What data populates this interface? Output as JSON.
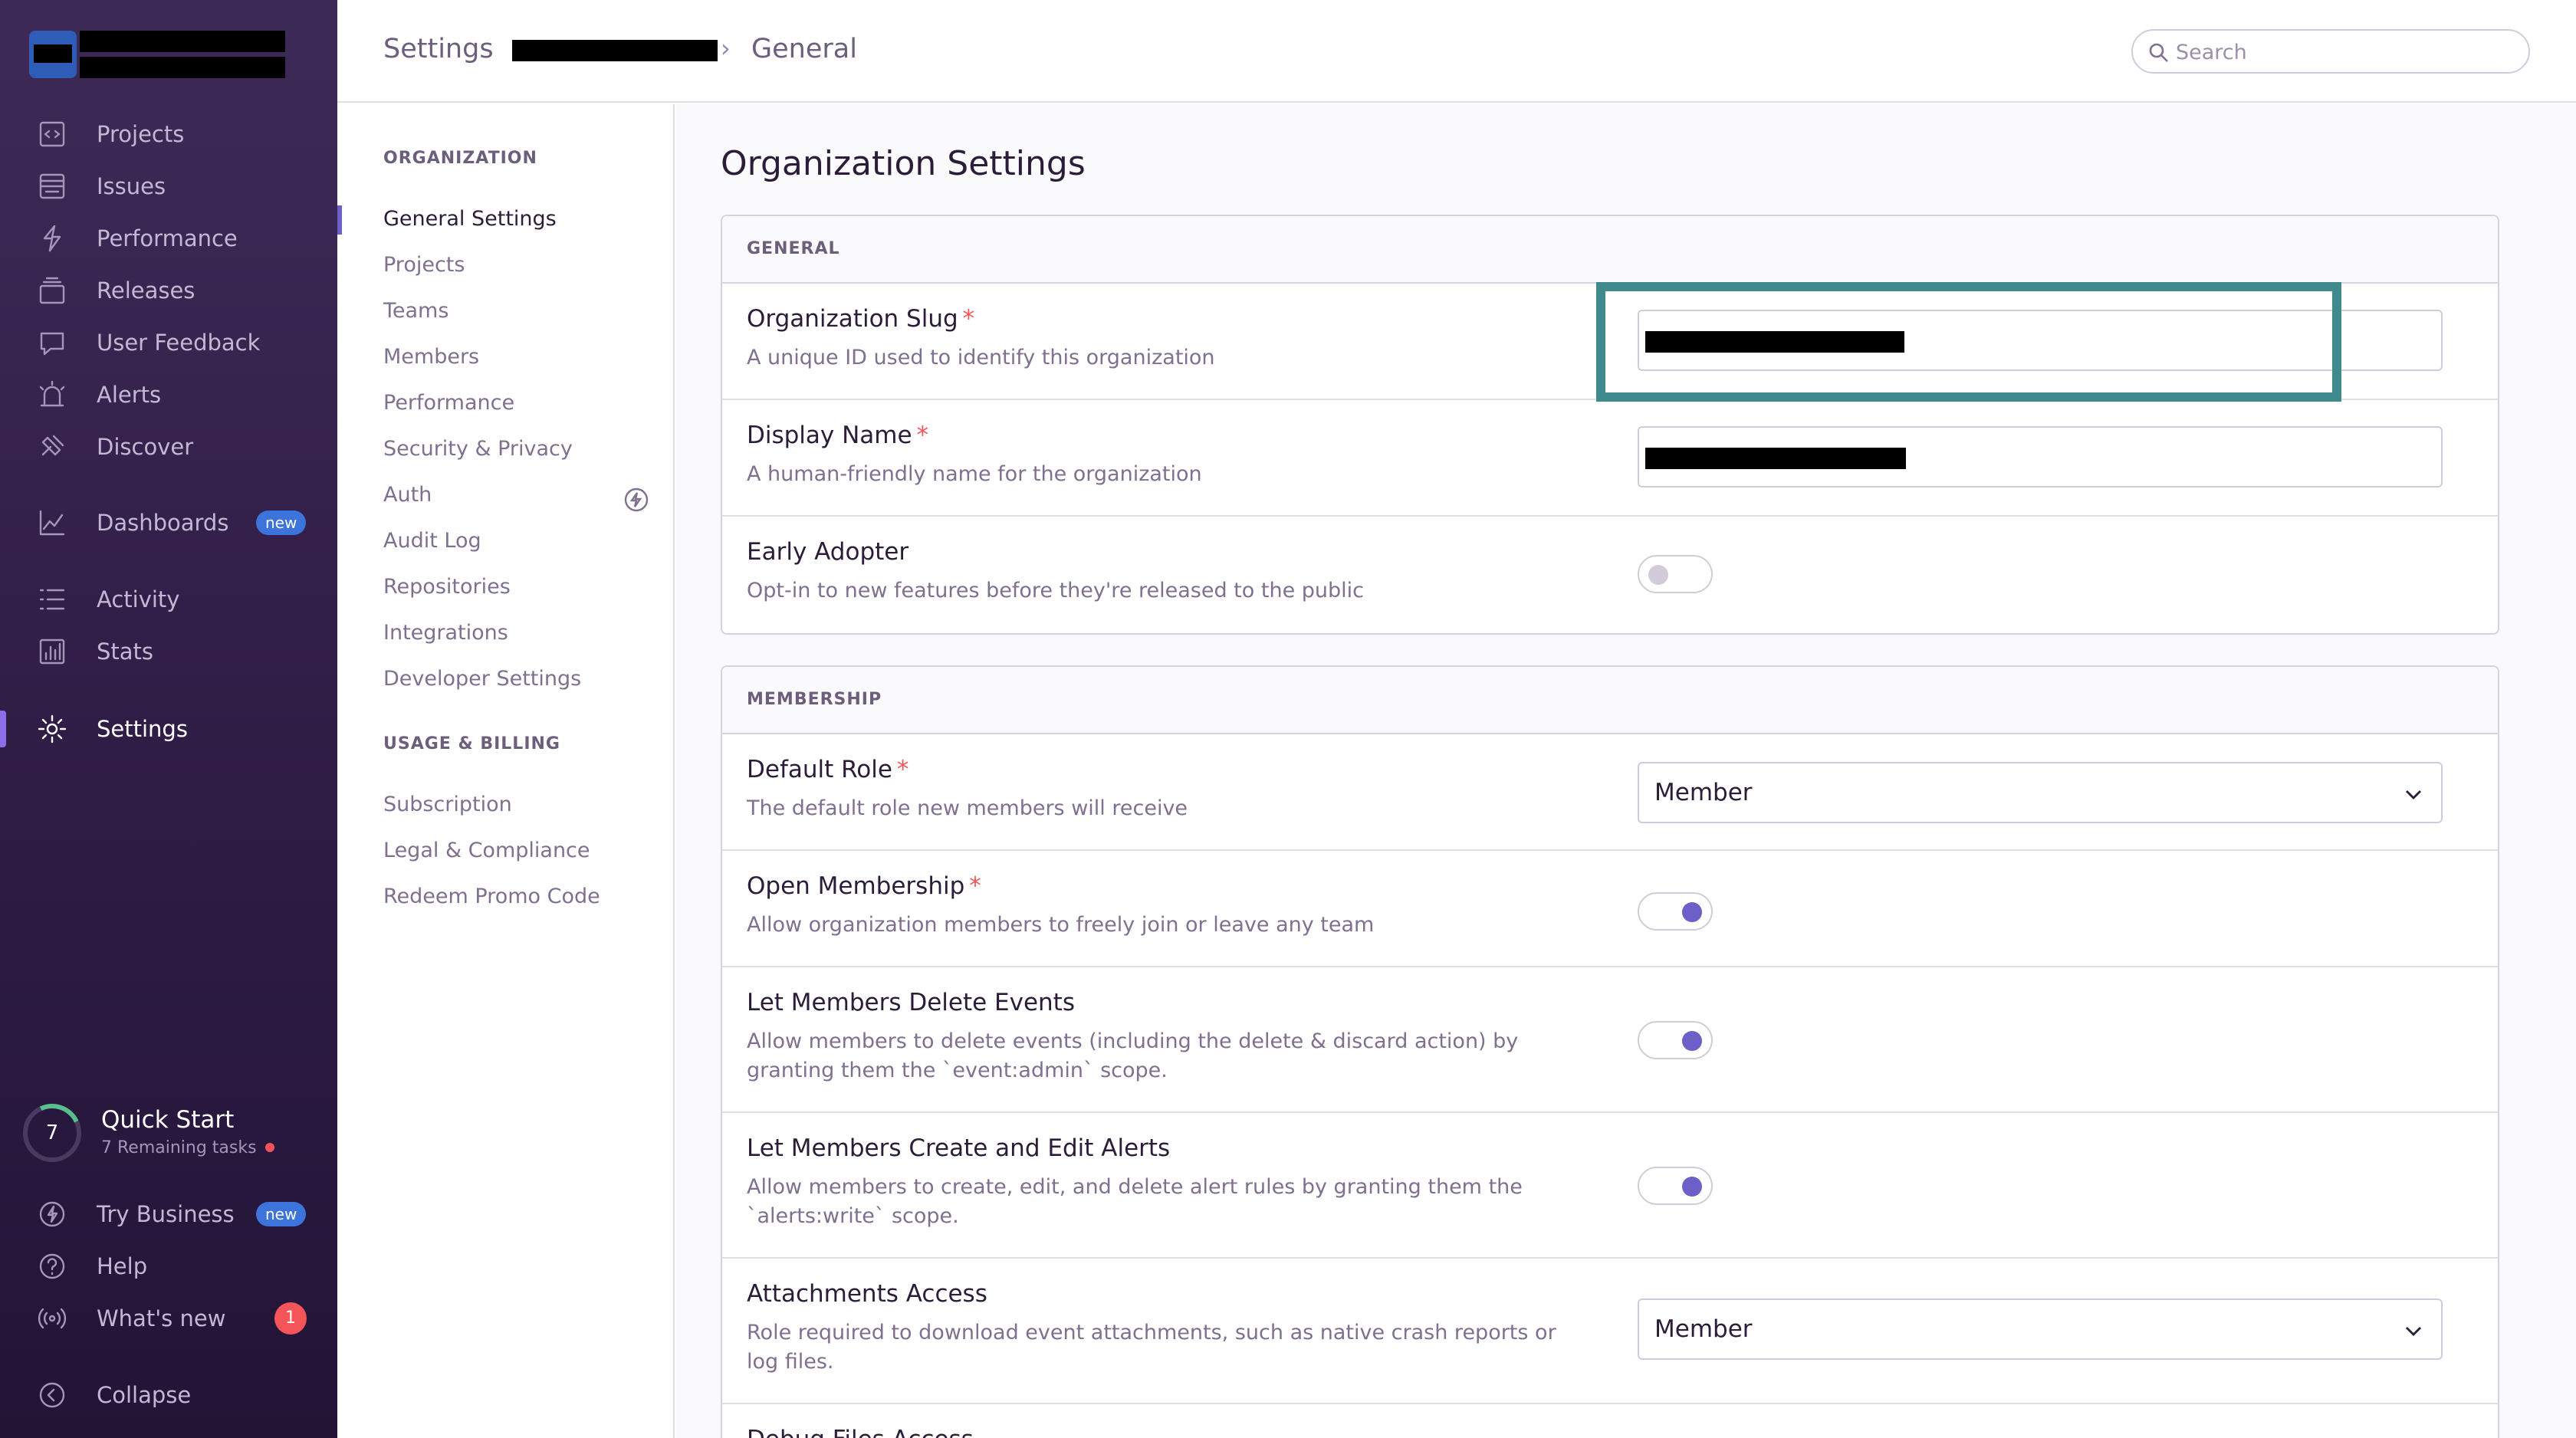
{
  "sidebar": {
    "nav_top": [
      {
        "label": "Projects",
        "icon": "projects-icon"
      },
      {
        "label": "Issues",
        "icon": "issues-icon"
      },
      {
        "label": "Performance",
        "icon": "performance-icon"
      },
      {
        "label": "Releases",
        "icon": "releases-icon"
      },
      {
        "label": "User Feedback",
        "icon": "user-feedback-icon"
      },
      {
        "label": "Alerts",
        "icon": "alerts-icon"
      },
      {
        "label": "Discover",
        "icon": "discover-icon"
      }
    ],
    "dashboards": {
      "label": "Dashboards",
      "badge": "new"
    },
    "activity": {
      "label": "Activity"
    },
    "stats": {
      "label": "Stats"
    },
    "settings": {
      "label": "Settings"
    },
    "quick_start": {
      "count": "7",
      "title": "Quick Start",
      "subtitle": "7 Remaining tasks"
    },
    "try_business": {
      "label": "Try Business",
      "badge": "new"
    },
    "help": {
      "label": "Help"
    },
    "whats_new": {
      "label": "What's new",
      "badge": "1"
    },
    "collapse": {
      "label": "Collapse"
    }
  },
  "header": {
    "crumb_settings": "Settings",
    "crumb_sep": "›",
    "crumb_current": "General",
    "search_placeholder": "Search"
  },
  "subnav": {
    "org_heading": "ORGANIZATION",
    "org_items": [
      "General Settings",
      "Projects",
      "Teams",
      "Members",
      "Performance",
      "Security & Privacy",
      "Auth",
      "Audit Log",
      "Repositories",
      "Integrations",
      "Developer Settings"
    ],
    "billing_heading": "USAGE & BILLING",
    "billing_items": [
      "Subscription",
      "Legal & Compliance",
      "Redeem Promo Code"
    ]
  },
  "main": {
    "title": "Organization Settings",
    "general": {
      "heading": "GENERAL",
      "slug": {
        "label": "Organization Slug",
        "required": "*",
        "help": "A unique ID used to identify this organization"
      },
      "display_name": {
        "label": "Display Name",
        "required": "*",
        "help": "A human-friendly name for the organization"
      },
      "early_adopter": {
        "label": "Early Adopter",
        "help": "Opt-in to new features before they're released to the public",
        "enabled": false
      }
    },
    "membership": {
      "heading": "MEMBERSHIP",
      "default_role": {
        "label": "Default Role",
        "required": "*",
        "help": "The default role new members will receive",
        "value": "Member"
      },
      "open_membership": {
        "label": "Open Membership",
        "required": "*",
        "help": "Allow organization members to freely join or leave any team",
        "enabled": true
      },
      "delete_events": {
        "label": "Let Members Delete Events",
        "help": "Allow members to delete events (including the delete & discard action) by granting them the `event:admin` scope.",
        "enabled": true
      },
      "create_alerts": {
        "label": "Let Members Create and Edit Alerts",
        "help": "Allow members to create, edit, and delete alert rules by granting them the `alerts:write` scope.",
        "enabled": true
      },
      "attachments": {
        "label": "Attachments Access",
        "help": "Role required to download event attachments, such as native crash reports or log files.",
        "value": "Member"
      },
      "debug_files": {
        "label": "Debug Files Access"
      }
    }
  },
  "colors": {
    "sidebar_bg": "#3e2a57",
    "accent": "#6c5fc7",
    "highlight": "#3f8a8c",
    "danger": "#f55459"
  }
}
